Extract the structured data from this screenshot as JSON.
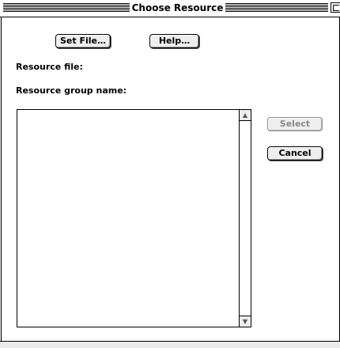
{
  "window": {
    "title": "Choose Resource"
  },
  "buttons": {
    "set_file": "Set File…",
    "help": "Help…",
    "select": "Select",
    "cancel": "Cancel"
  },
  "labels": {
    "resource_file": "Resource file:",
    "resource_group_name": "Resource group name:"
  },
  "list": {
    "items": [],
    "scroll_up_icon": "triangle-up",
    "scroll_down_icon": "triangle-down"
  },
  "state": {
    "select_enabled": false
  }
}
